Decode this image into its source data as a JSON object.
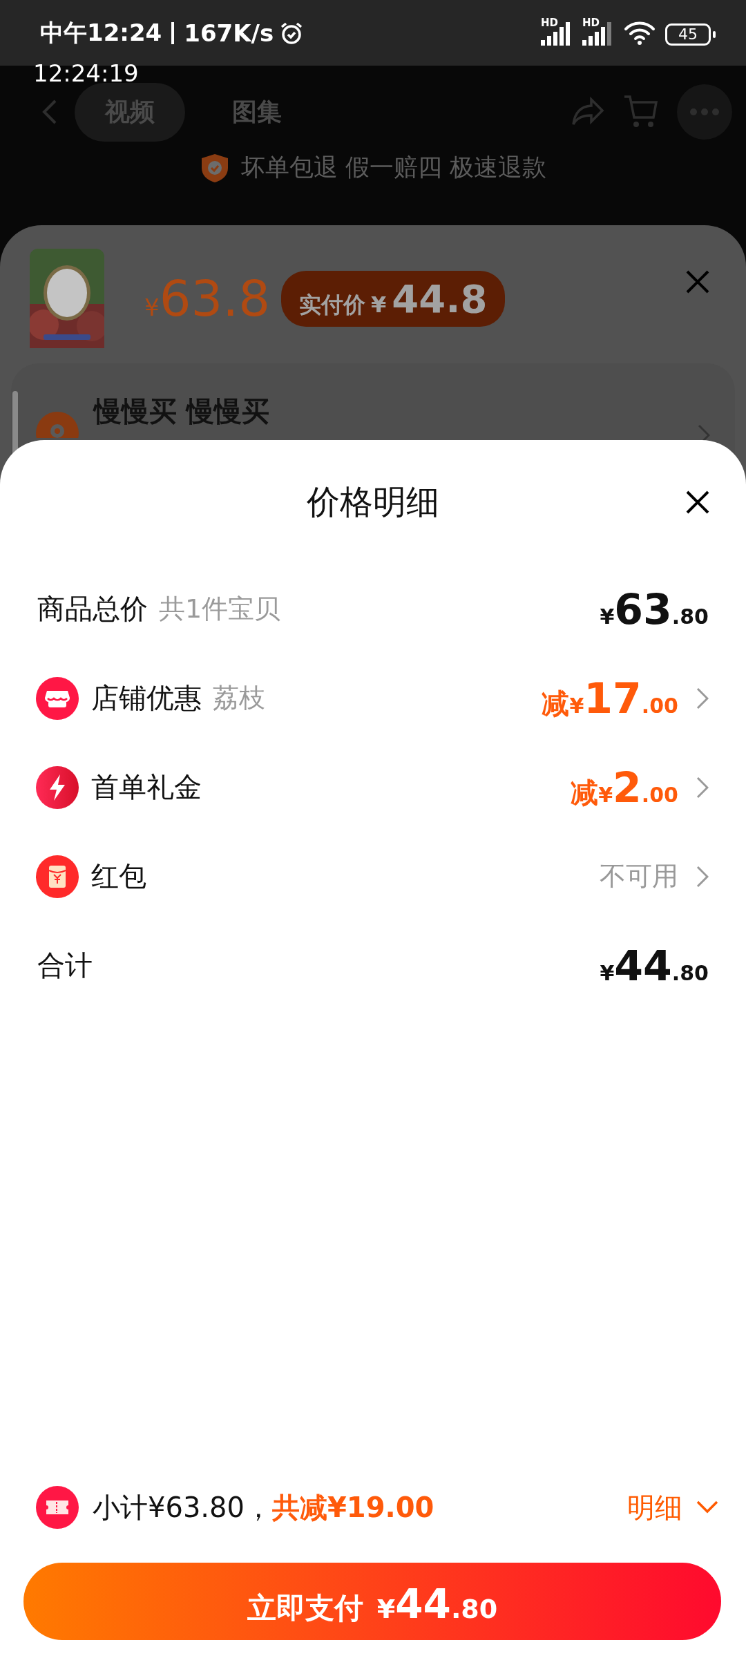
{
  "status_bar": {
    "time": "中午12:24",
    "speed": "167K/s",
    "network_labels": [
      "HD",
      "HD"
    ],
    "battery": "45"
  },
  "clock_overlay": "12:24:19",
  "background_page": {
    "tabs": [
      {
        "label": "视频",
        "selected": true
      },
      {
        "label": "图集",
        "selected": false
      }
    ],
    "guarantee": "坏单包退 假一赔四 极速退款"
  },
  "sku_sheet": {
    "currency": "¥",
    "price": "63.8",
    "actual_price_label": "实付价",
    "actual_price_currency": "¥",
    "actual_price": "44.8",
    "address": "慢慢买 慢慢买"
  },
  "price_detail": {
    "title": "价格明细",
    "rows": [
      {
        "kind": "plain",
        "label": "商品总价",
        "note": "共1件宝贝",
        "prefix": "",
        "currency": "¥",
        "integer": "63",
        "decimal": ".80",
        "highlight": false
      },
      {
        "kind": "shop_discount",
        "label": "店铺优惠",
        "note": "荔枝",
        "prefix": "减",
        "currency": "¥",
        "integer": "17",
        "decimal": ".00",
        "highlight": true
      },
      {
        "kind": "first_order",
        "label": "首单礼金",
        "prefix": "减",
        "currency": "¥",
        "integer": "2",
        "decimal": ".00",
        "highlight": true
      },
      {
        "kind": "hongbao",
        "label": "红包",
        "value_text": "不可用"
      },
      {
        "kind": "plain",
        "label": "合计",
        "prefix": "",
        "currency": "¥",
        "integer": "44",
        "decimal": ".80",
        "highlight": false
      }
    ]
  },
  "footer": {
    "subtotal": "小计¥63.80，",
    "savings": "共减¥19.00",
    "detail_link": "明细",
    "pay_button": {
      "label": "立即支付",
      "currency": "¥",
      "integer": "44",
      "decimal": ".80"
    }
  }
}
